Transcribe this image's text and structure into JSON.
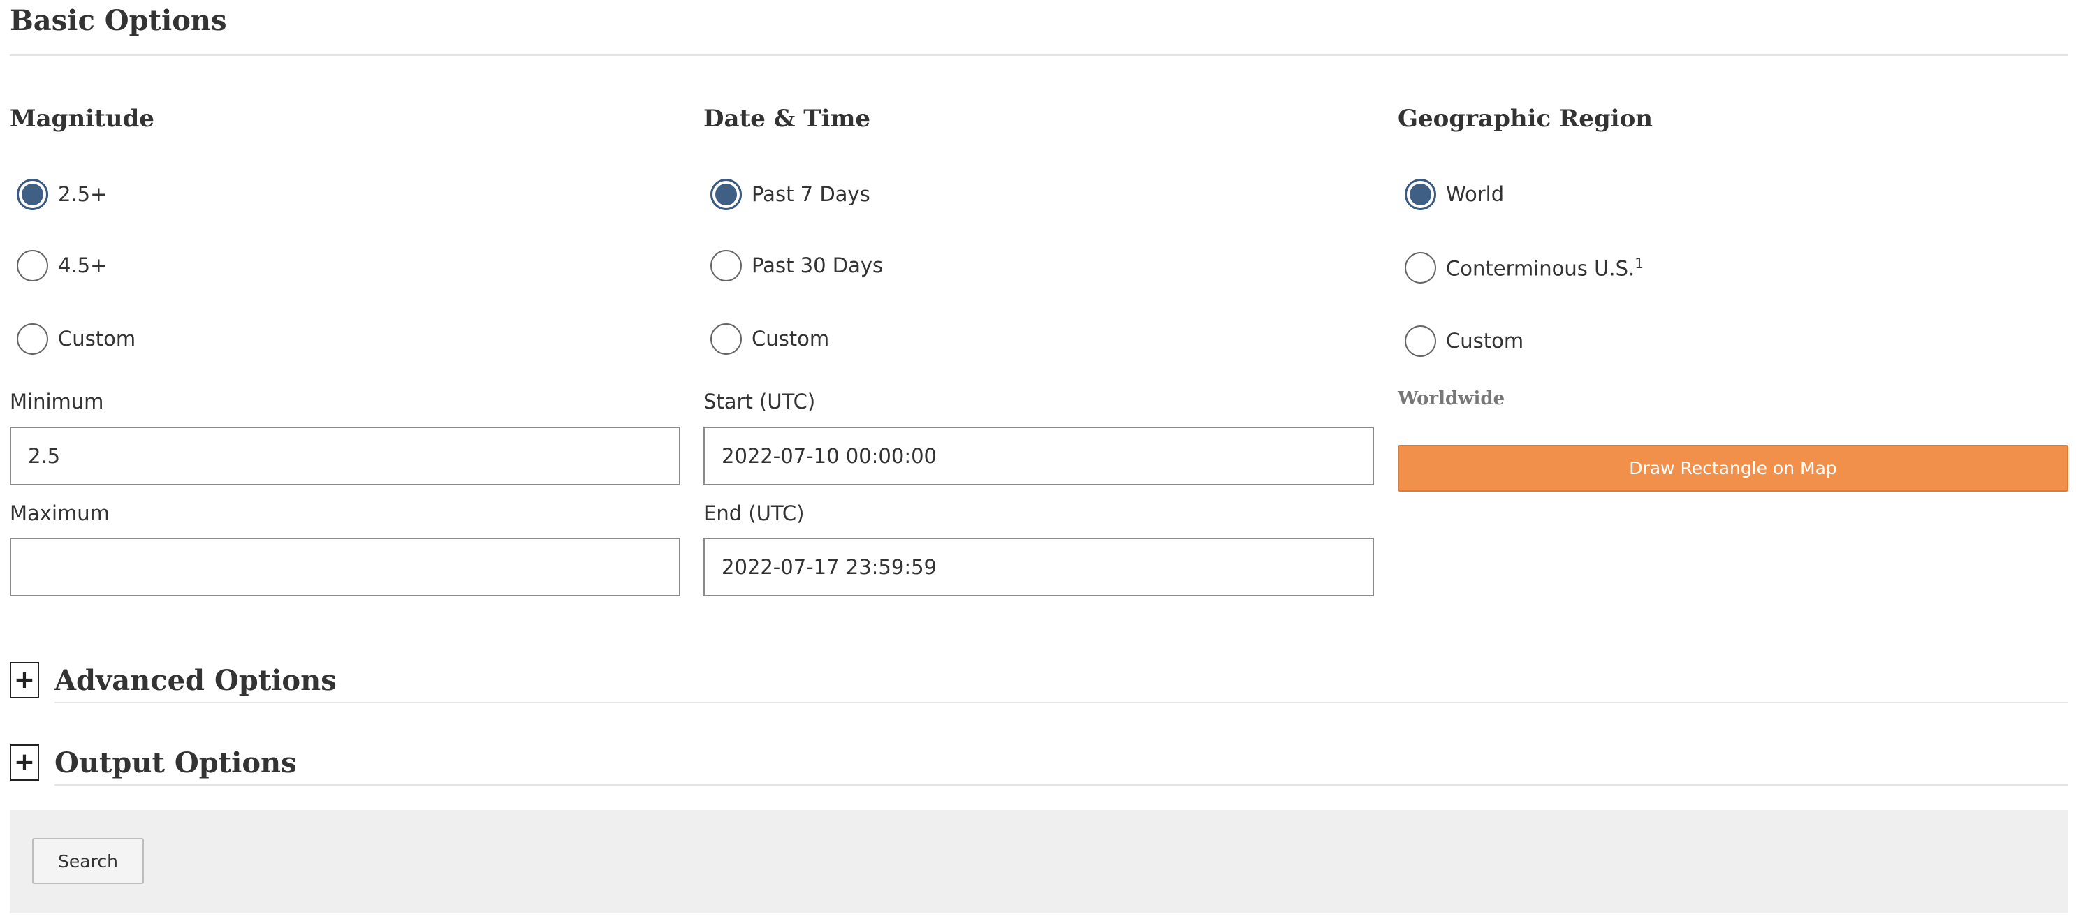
{
  "basic_options": {
    "title": "Basic Options"
  },
  "magnitude": {
    "heading": "Magnitude",
    "options": [
      {
        "label": "2.5+",
        "checked": true
      },
      {
        "label": "4.5+",
        "checked": false
      },
      {
        "label": "Custom",
        "checked": false
      }
    ],
    "minimum_label": "Minimum",
    "minimum_value": "2.5",
    "maximum_label": "Maximum",
    "maximum_value": ""
  },
  "datetime": {
    "heading": "Date & Time",
    "options": [
      {
        "label": "Past 7 Days",
        "checked": true
      },
      {
        "label": "Past 30 Days",
        "checked": false
      },
      {
        "label": "Custom",
        "checked": false
      }
    ],
    "start_label": "Start (UTC)",
    "start_value": "2022-07-10 00:00:00",
    "end_label": "End (UTC)",
    "end_value": "2022-07-17 23:59:59"
  },
  "region": {
    "heading": "Geographic Region",
    "options": [
      {
        "label": "World",
        "checked": true
      },
      {
        "label": "Conterminous U.S.",
        "sup": "1",
        "checked": false
      },
      {
        "label": "Custom",
        "checked": false
      }
    ],
    "note": "Worldwide",
    "draw_button": "Draw Rectangle on Map"
  },
  "advanced_options": {
    "toggle": "+",
    "title": "Advanced Options"
  },
  "output_options": {
    "toggle": "+",
    "title": "Output Options"
  },
  "search": {
    "button_label": "Search"
  },
  "colors": {
    "radio_checked": "#3f5f85",
    "draw_button": "#f0904a",
    "search_bar_bg": "#efefef"
  }
}
